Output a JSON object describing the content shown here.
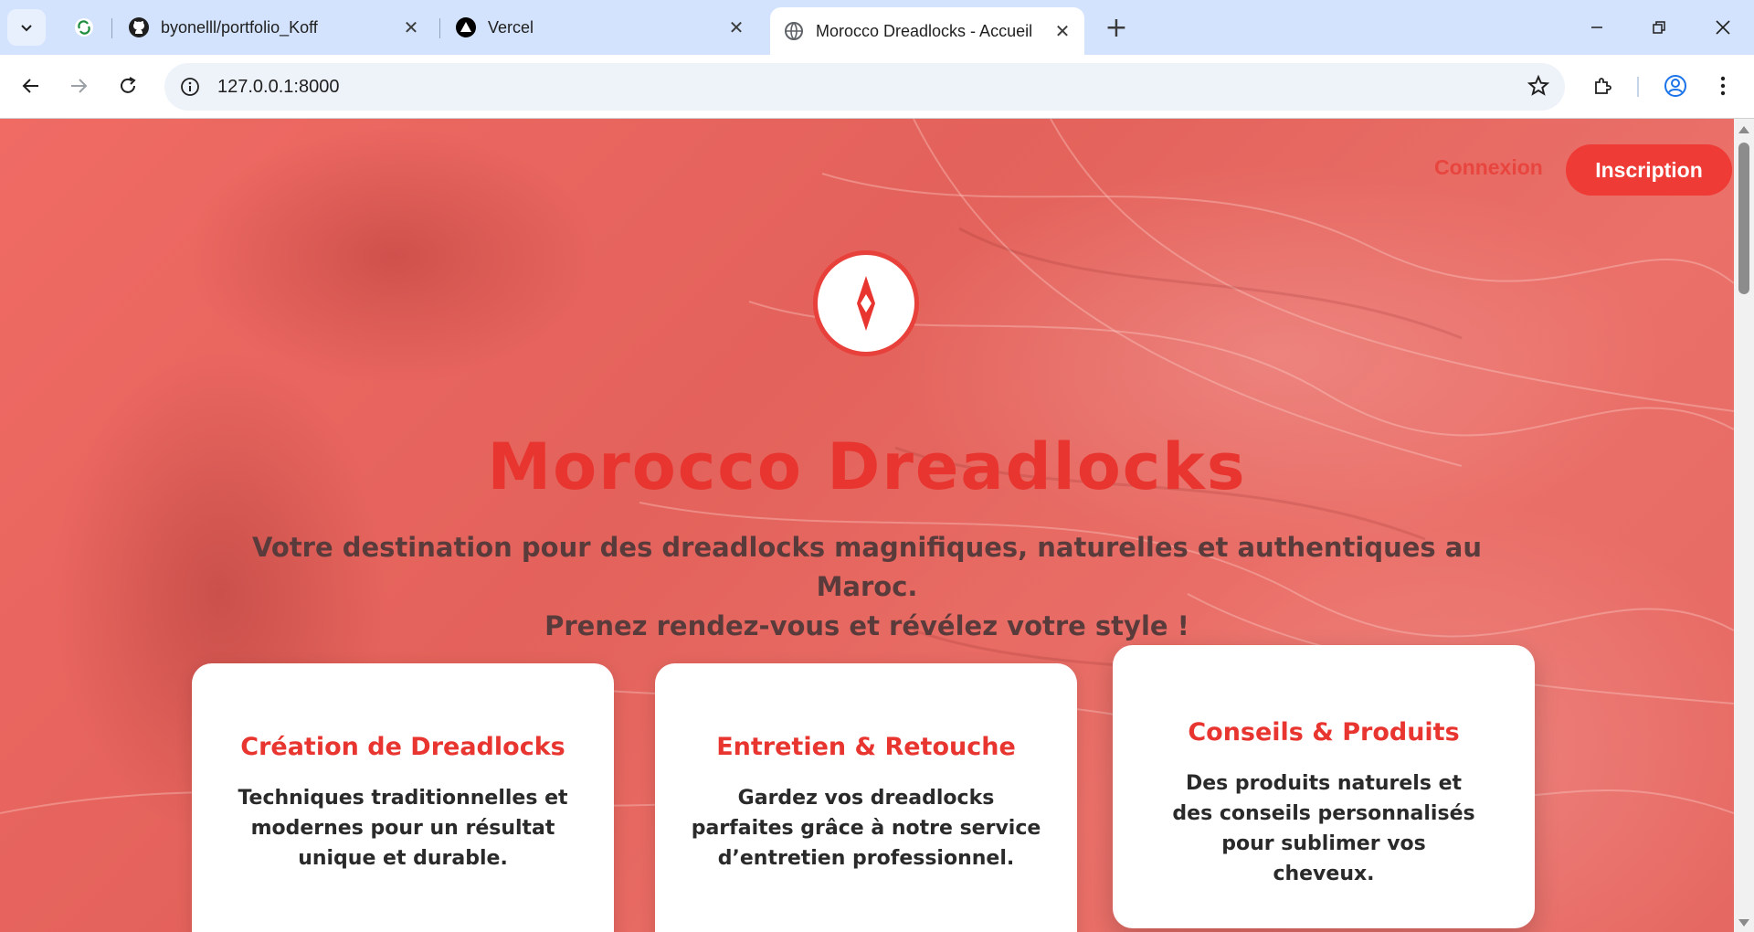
{
  "browser": {
    "tabs": [
      {
        "label": "",
        "icon": "refresh-app-icon"
      },
      {
        "label": "byonelll/portfolio_Koff",
        "icon": "github-icon"
      },
      {
        "label": "Vercel",
        "icon": "vercel-icon"
      },
      {
        "label": "Morocco Dreadlocks - Accueil",
        "icon": "globe-icon",
        "active": true
      }
    ],
    "url": "127.0.0.1:8000"
  },
  "nav": {
    "login": "Connexion",
    "signup": "Inscription"
  },
  "hero": {
    "title": "Morocco Dreadlocks",
    "subtitle_line1": "Votre destination pour des dreadlocks magnifiques, naturelles et authentiques au Maroc.",
    "subtitle_line2": "Prenez rendez-vous et révélez votre style !"
  },
  "cards": [
    {
      "title": "Création de Dreadlocks",
      "text": "Techniques traditionnelles et modernes pour un résultat unique et durable."
    },
    {
      "title": "Entretien & Retouche",
      "text": "Gardez vos dreadlocks parfaites grâce à notre service d’entretien professionnel."
    },
    {
      "title": "Conseils & Produits",
      "text": "Des produits naturels et des conseils personnalisés pour sublimer vos cheveux."
    }
  ],
  "colors": {
    "accent": "#e8352f",
    "hero_overlay": "#e76a63",
    "tabstrip": "#d3e3fd"
  }
}
